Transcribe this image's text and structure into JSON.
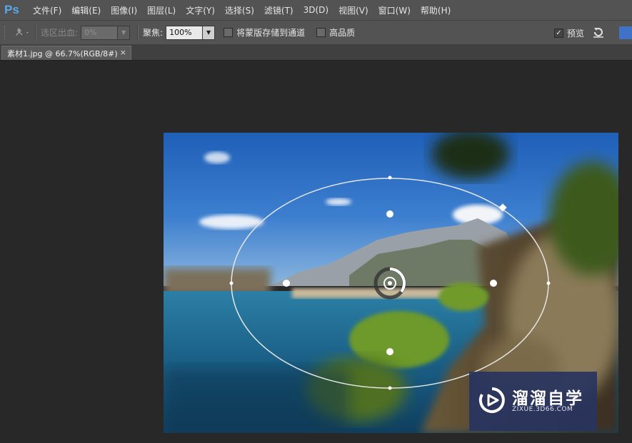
{
  "app": {
    "logo": "Ps"
  },
  "menu": [
    {
      "label": "文件(F)"
    },
    {
      "label": "编辑(E)"
    },
    {
      "label": "图像(I)"
    },
    {
      "label": "图层(L)"
    },
    {
      "label": "文字(Y)"
    },
    {
      "label": "选择(S)"
    },
    {
      "label": "滤镜(T)"
    },
    {
      "label": "3D(D)"
    },
    {
      "label": "视图(V)"
    },
    {
      "label": "窗口(W)"
    },
    {
      "label": "帮助(H)"
    }
  ],
  "options": {
    "tool_icon": "pin-tool-icon",
    "selection_bleed_label": "选区出血:",
    "selection_bleed_value": "0%",
    "focus_label": "聚焦:",
    "focus_value": "100%",
    "save_mask_label": "将蒙版存储到通道",
    "save_mask_checked": false,
    "high_quality_label": "高品质",
    "high_quality_checked": false,
    "preview_label": "预览",
    "preview_checked": true,
    "reset_icon": "reset-icon"
  },
  "document_tab": {
    "title": "素材1.jpg @ 66.7%(RGB/8#)",
    "close": "×"
  },
  "watermark": {
    "name": "溜溜自学",
    "url": "ZIXUE.3D66.COM",
    "icon": "play-logo-icon"
  },
  "colors": {
    "accent": "#3f73c7",
    "menubar": "#535353",
    "workspace": "#282828"
  }
}
